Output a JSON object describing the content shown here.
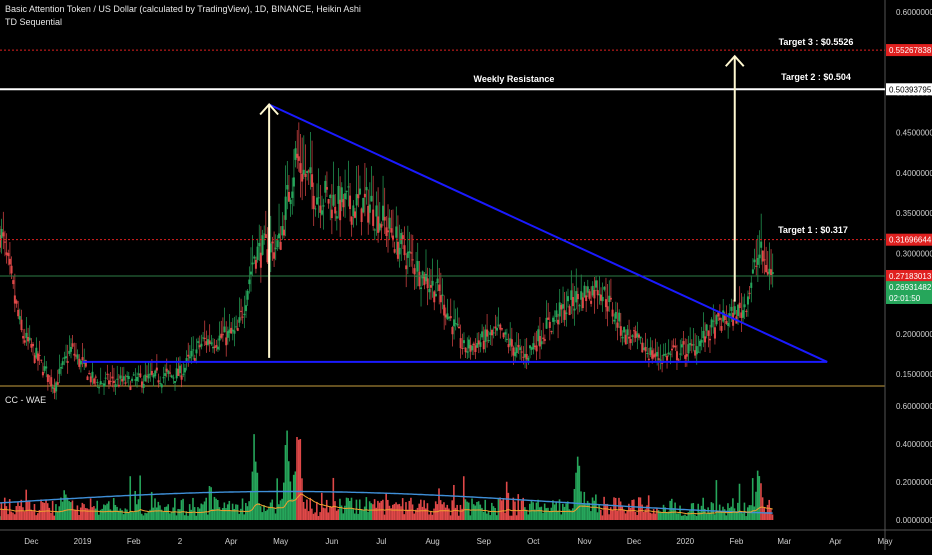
{
  "header": {
    "symbol_title": "Basic Attention Token / US Dollar (calculated by TradingView), 1D, BINANCE, Heikin Ashi",
    "indicator": "TD Sequential",
    "lower_indicator": "CC - WAE"
  },
  "annotations": {
    "weekly_resistance": "Weekly Resistance",
    "target1": "Target 1 : $0.317",
    "target2": "Target 2 : $0.504",
    "target3": "Target 3 : $0.5526"
  },
  "price_badges": {
    "target3": "0.55267838",
    "target2": "0.50393795",
    "target1": "0.31696644",
    "last": "0.27183013",
    "prev": "0.26931482",
    "countdown": "02:01:50"
  },
  "colors": {
    "background": "#000000",
    "up": "#26a65b",
    "down": "#e04848",
    "triangle": "#1a1aff",
    "target_line": "#e0201f",
    "resistance": "#ffffff",
    "arrow": "#fff8d0",
    "wae_line": "#3f8fd8",
    "wae_dead": "#f0a030"
  },
  "chart_data": [
    {
      "type": "candlestick",
      "title": "Basic Attention Token / US Dollar (calculated by TradingView), 1D, BINANCE, Heikin Ashi",
      "y_ticks": [
        "0.60000000",
        "0.55000000",
        "0.50000000",
        "0.45000000",
        "0.40000000",
        "0.35000000",
        "0.30000000",
        "0.25000000",
        "0.20000000",
        "0.15000000"
      ],
      "x_ticks": [
        "Dec",
        "2019",
        "Feb",
        "2",
        "Apr",
        "May",
        "Jun",
        "Jul",
        "Aug",
        "Sep",
        "Oct",
        "Nov",
        "Dec",
        "2020",
        "Feb",
        "Mar",
        "Apr",
        "May"
      ],
      "ylim": [
        0.13,
        0.61
      ],
      "close_path": [
        {
          "date": "2018-11-12",
          "value": 0.33
        },
        {
          "date": "2018-11-25",
          "value": 0.2
        },
        {
          "date": "2018-12-15",
          "value": 0.135
        },
        {
          "date": "2018-12-25",
          "value": 0.18
        },
        {
          "date": "2019-01-08",
          "value": 0.14
        },
        {
          "date": "2019-01-30",
          "value": 0.14
        },
        {
          "date": "2019-03-01",
          "value": 0.15
        },
        {
          "date": "2019-03-15",
          "value": 0.19
        },
        {
          "date": "2019-04-05",
          "value": 0.2
        },
        {
          "date": "2019-04-15",
          "value": 0.3
        },
        {
          "date": "2019-04-30",
          "value": 0.31
        },
        {
          "date": "2019-05-10",
          "value": 0.42
        },
        {
          "date": "2019-05-20",
          "value": 0.38
        },
        {
          "date": "2019-06-05",
          "value": 0.36
        },
        {
          "date": "2019-06-25",
          "value": 0.36
        },
        {
          "date": "2019-07-15",
          "value": 0.3
        },
        {
          "date": "2019-08-05",
          "value": 0.25
        },
        {
          "date": "2019-08-20",
          "value": 0.18
        },
        {
          "date": "2019-09-10",
          "value": 0.2
        },
        {
          "date": "2019-09-25",
          "value": 0.17
        },
        {
          "date": "2019-10-10",
          "value": 0.21
        },
        {
          "date": "2019-10-25",
          "value": 0.24
        },
        {
          "date": "2019-11-10",
          "value": 0.26
        },
        {
          "date": "2019-11-25",
          "value": 0.2
        },
        {
          "date": "2019-12-15",
          "value": 0.17
        },
        {
          "date": "2020-01-05",
          "value": 0.18
        },
        {
          "date": "2020-01-20",
          "value": 0.21
        },
        {
          "date": "2020-02-05",
          "value": 0.23
        },
        {
          "date": "2020-02-15",
          "value": 0.3
        },
        {
          "date": "2020-02-23",
          "value": 0.27
        }
      ],
      "horizontal_levels": [
        {
          "label": "Target 3 : $0.5526",
          "value": 0.55267838,
          "style": "dotted"
        },
        {
          "label": "Weekly Resistance",
          "value": 0.50393795,
          "style": "solid"
        },
        {
          "label": "Target 1 : $0.317",
          "value": 0.31696644,
          "style": "dotted"
        },
        {
          "value": 0.27183013,
          "style": "solid"
        }
      ],
      "trendlines": [
        {
          "from": {
            "date": "2019-04-24",
            "value": 0.485
          },
          "to": {
            "date": "2020-03-27",
            "value": 0.165
          }
        },
        {
          "from": {
            "date": "2019-01-01",
            "value": 0.165
          },
          "to": {
            "date": "2020-03-27",
            "value": 0.165
          }
        }
      ],
      "arrows": [
        {
          "x": "2019-04-24",
          "from": 0.17,
          "to": 0.485
        },
        {
          "x": "2020-01-31",
          "from": 0.24,
          "to": 0.545
        }
      ]
    },
    {
      "type": "bar",
      "title": "CC - WAE",
      "y_ticks": [
        "0.60000000",
        "0.40000000",
        "0.20000000",
        "0.00000000"
      ],
      "ylim": [
        0,
        0.65
      ],
      "peaks": [
        {
          "date": "2019-04-15",
          "value": 0.5
        },
        {
          "date": "2019-05-05",
          "value": 0.6
        },
        {
          "date": "2019-05-12",
          "value": 0.62
        },
        {
          "date": "2019-10-28",
          "value": 0.41
        },
        {
          "date": "2020-02-15",
          "value": 0.37
        }
      ]
    }
  ]
}
